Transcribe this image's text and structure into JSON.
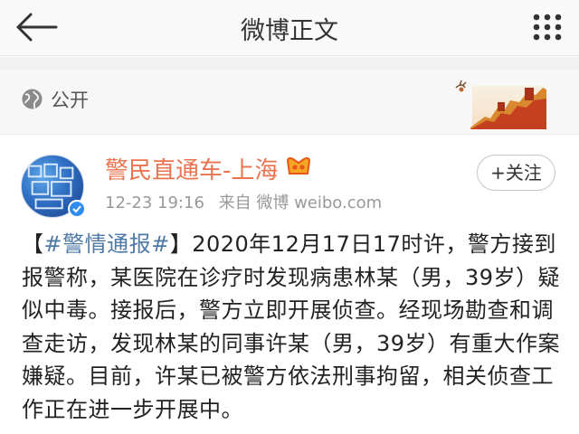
{
  "nav": {
    "title": "微博正文"
  },
  "visibility": {
    "label": "公开"
  },
  "author": {
    "name": "警民直通车-上海",
    "timestamp": "12-23 19:16",
    "source": "来自 微博 weibo.com",
    "follow_label": "+关注"
  },
  "post": {
    "bracket_open": "【",
    "hashtag": "#警情通报#",
    "bracket_close": "】",
    "text": "2020年12月17日17时许，警方接到报警称，某医院在诊疗时发现病患林某（男，39岁）疑似中毒。接报后，警方立即开展侦查。经现场勘查和调查走访，发现林某的同事许某（男，39岁）有重大作案嫌疑。目前，许某已被警方依法刑事拘留，相关侦查工作正在进一步开展中。"
  },
  "colors": {
    "author_name": "#eb7350",
    "hashtag": "#4e79a7",
    "meta": "#999999",
    "verified_badge": "#2f8df0"
  },
  "icons": [
    "back-arrow-icon",
    "more-dots-icon",
    "globe-icon",
    "great-wall-banner",
    "vip-icon",
    "verified-icon"
  ]
}
